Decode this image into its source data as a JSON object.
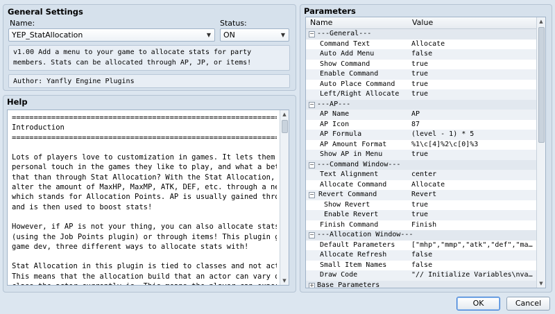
{
  "general": {
    "title": "General Settings",
    "name_label": "Name:",
    "status_label": "Status:",
    "name_value": "YEP_StatAllocation",
    "status_value": "ON",
    "description": "v1.00 Add a menu to your game to allocate stats for party members. Stats can be allocated through AP, JP, or items!",
    "author": "Author: Yanfly Engine Plugins"
  },
  "help": {
    "title": "Help",
    "lines": [
      "=================================================================",
      "Introduction",
      "=================================================================",
      "",
      "Lots of players love to customization in games. It lets them put a bit of a",
      "personal touch in the games they like to play, and what a better way to do",
      "that than through Stat Allocation? With the Stat Allocation, players can",
      "alter the amount of MaxHP, MaxMP, ATK, DEF, etc. through a new resource, AP,",
      "which stands for Allocation Points. AP is usually gained through leveling up",
      "and is then used to boost stats!",
      "",
      "However, if AP is not your thing, you can also allocate stats through JP",
      "(using the Job Points plugin) or through items! This plugin gives you, the",
      "game dev, three different ways to allocate stats with!",
      "",
      "Stat Allocation in this plugin is tied to classes and not actors as a whole.",
      "This means that the allocation build that an actor can vary depending on the",
      "class the actor currently is. This means the player can experiment with"
    ]
  },
  "params": {
    "title": "Parameters",
    "col_name": "Name",
    "col_value": "Value",
    "rows": [
      {
        "name": "---General---",
        "value": "",
        "group": true,
        "expander": "−"
      },
      {
        "name": "Command Text",
        "value": "Allocate",
        "indent": 1
      },
      {
        "name": "Auto Add Menu",
        "value": "false",
        "indent": 1
      },
      {
        "name": "Show Command",
        "value": "true",
        "indent": 1
      },
      {
        "name": "Enable Command",
        "value": "true",
        "indent": 1
      },
      {
        "name": "Auto Place Command",
        "value": "true",
        "indent": 1
      },
      {
        "name": "Left/Right Allocate",
        "value": "true",
        "indent": 1
      },
      {
        "name": "---AP---",
        "value": "",
        "group": true,
        "expander": "−"
      },
      {
        "name": "AP Name",
        "value": "AP",
        "indent": 1
      },
      {
        "name": "AP Icon",
        "value": "87",
        "indent": 1
      },
      {
        "name": "AP Formula",
        "value": "(level - 1) * 5",
        "indent": 1
      },
      {
        "name": "AP Amount Format",
        "value": "%1\\c[4]%2\\c[0]%3",
        "indent": 1
      },
      {
        "name": "Show AP in Menu",
        "value": "true",
        "indent": 1
      },
      {
        "name": "---Command Window---",
        "value": "",
        "group": true,
        "expander": "−"
      },
      {
        "name": "Text Alignment",
        "value": "center",
        "indent": 1
      },
      {
        "name": "Allocate Command",
        "value": "Allocate",
        "indent": 1
      },
      {
        "name": "Revert Command",
        "value": "Revert",
        "indent": 0,
        "expander": "−"
      },
      {
        "name": "Show Revert",
        "value": "true",
        "indent": 2
      },
      {
        "name": "Enable Revert",
        "value": "true",
        "indent": 2
      },
      {
        "name": "Finish Command",
        "value": "Finish",
        "indent": 1
      },
      {
        "name": "---Allocation Window---",
        "value": "",
        "group": true,
        "expander": "−"
      },
      {
        "name": "Default Parameters",
        "value": "[\"mhp\",\"mmp\",\"atk\",\"def\",\"mat\",\"md…",
        "indent": 1
      },
      {
        "name": "Allocate Refresh",
        "value": "false",
        "indent": 1
      },
      {
        "name": "Small Item Names",
        "value": "false",
        "indent": 1
      },
      {
        "name": "Draw Code",
        "value": "\"// Initialize Variables\\nvar para…",
        "indent": 1
      },
      {
        "name": "Base Parameters",
        "value": "",
        "group": true,
        "expander": "+"
      }
    ]
  },
  "buttons": {
    "ok": "OK",
    "cancel": "Cancel"
  }
}
